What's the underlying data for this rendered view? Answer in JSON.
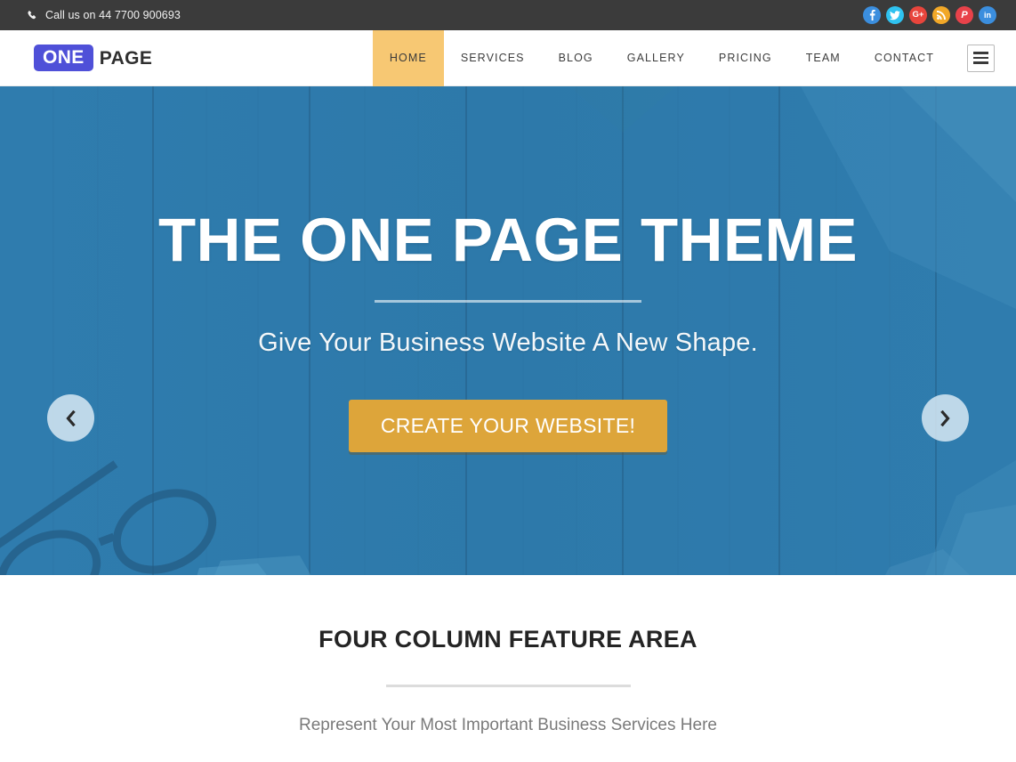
{
  "topbar": {
    "phone_icon": "phone-icon",
    "phone_text": "Call us on 44 7700 900693",
    "socials": [
      {
        "name": "facebook",
        "glyph": "f",
        "color": "#3b8ede"
      },
      {
        "name": "twitter",
        "glyph": "t",
        "color": "#2fc2f0"
      },
      {
        "name": "google-plus",
        "glyph": "G+",
        "color": "#e8453c"
      },
      {
        "name": "rss",
        "glyph": "r",
        "color": "#f2a828"
      },
      {
        "name": "pinterest",
        "glyph": "P",
        "color": "#e8424a"
      },
      {
        "name": "linkedin",
        "glyph": "in",
        "color": "#3b8ede"
      }
    ]
  },
  "header": {
    "logo_badge": "ONE",
    "logo_word": "PAGE",
    "logo_badge_color": "#4f50d8",
    "nav": [
      {
        "label": "HOME",
        "active": true
      },
      {
        "label": "SERVICES",
        "active": false
      },
      {
        "label": "BLOG",
        "active": false
      },
      {
        "label": "GALLERY",
        "active": false
      },
      {
        "label": "PRICING",
        "active": false
      },
      {
        "label": "TEAM",
        "active": false
      },
      {
        "label": "CONTACT",
        "active": false
      }
    ],
    "active_color": "#f7c873",
    "menu_icon": "hamburger-icon"
  },
  "hero": {
    "title": "THE ONE PAGE THEME",
    "subtitle": "Give Your Business Website A New Shape.",
    "cta_label": "CREATE YOUR WEBSITE!",
    "cta_color": "#dda53a",
    "background_color": "#2e7bad",
    "prev_icon": "chevron-left-icon",
    "next_icon": "chevron-right-icon"
  },
  "feature": {
    "title": "FOUR COLUMN FEATURE AREA",
    "subtitle": "Represent Your Most Important Business Services Here"
  }
}
